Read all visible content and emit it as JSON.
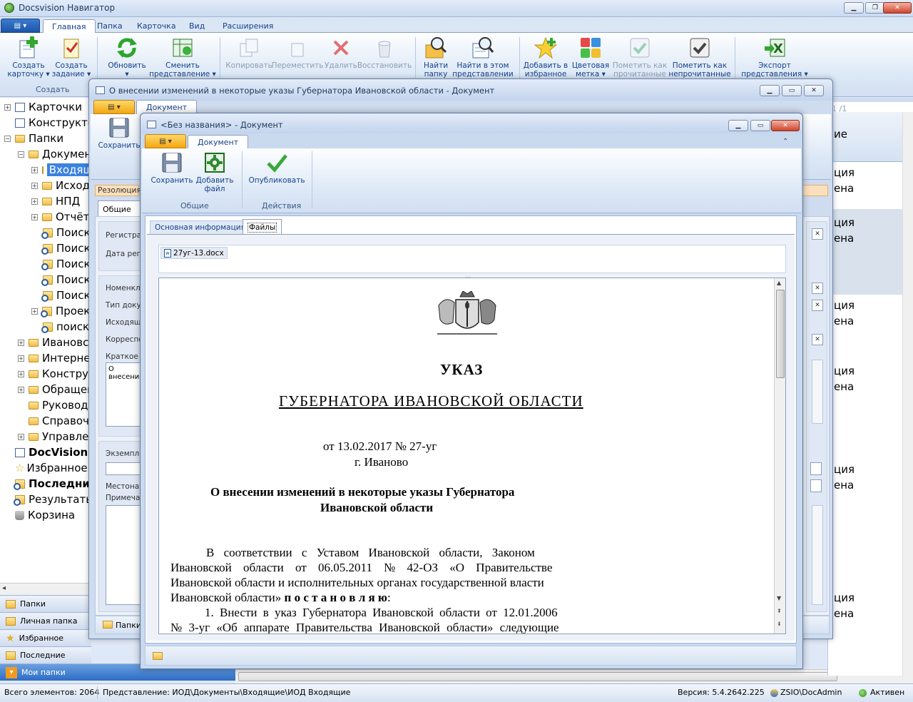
{
  "app": {
    "title": "Docsvision Навигатор",
    "menu_tabs": [
      "Главная",
      "Папка",
      "Карточка",
      "Вид",
      "Расширения"
    ]
  },
  "ribbon": {
    "create_card": "Создать\nкарточку ▾",
    "create_task": "Создать\nзадание ▾",
    "group_create": "Создать",
    "refresh": "Обновить\n▾",
    "change_view": "Сменить\nпредставление ▾",
    "copy": "Копировать",
    "move": "Переместить",
    "delete": "Удалить",
    "restore": "Восстановить",
    "find_folder": "Найти\nпапку",
    "find_in_view": "Найти в этом\nпредставлении",
    "add_favorite": "Добавить в\nизбранное",
    "color_mark": "Цветовая\nметка ▾",
    "mark_read": "Пометить как\nпрочитанные",
    "mark_unread": "Пометить как\nнепрочитанные",
    "export_view": "Экспорт\nпредставления ▾"
  },
  "tree": {
    "items": [
      {
        "label": "Карточки",
        "expander": "+"
      },
      {
        "label": "Конструктор",
        "expander": ""
      },
      {
        "label": "Папки",
        "expander": "−"
      },
      {
        "label": "Документы",
        "expander": "−"
      },
      {
        "label": "Входящие",
        "expander": "+"
      },
      {
        "label": "Исходящие",
        "expander": "+"
      },
      {
        "label": "НПД",
        "expander": "+"
      },
      {
        "label": "Отчёты",
        "expander": "+"
      },
      {
        "label": "Поиск",
        "expander": ""
      },
      {
        "label": "Поиск",
        "expander": ""
      },
      {
        "label": "Поиск",
        "expander": ""
      },
      {
        "label": "Поиск",
        "expander": ""
      },
      {
        "label": "Поиск",
        "expander": ""
      },
      {
        "label": "Проекты",
        "expander": "+"
      },
      {
        "label": "поиск",
        "expander": ""
      },
      {
        "label": "Ивановской",
        "expander": "+"
      },
      {
        "label": "Интернет",
        "expander": "+"
      },
      {
        "label": "Конструктор",
        "expander": "+"
      },
      {
        "label": "Обращения",
        "expander": "+"
      },
      {
        "label": "Руководство",
        "expander": ""
      },
      {
        "label": "Справочники",
        "expander": ""
      },
      {
        "label": "Управление",
        "expander": "+"
      },
      {
        "label": "DocVision Архив",
        "expander": ""
      },
      {
        "label": "Избранное",
        "expander": ""
      },
      {
        "label": "Последние",
        "expander": ""
      },
      {
        "label": "Результаты",
        "expander": ""
      },
      {
        "label": "Корзина",
        "expander": ""
      }
    ]
  },
  "nav": {
    "folders": "Папки",
    "personal": "Личная папка",
    "favorites": "Избранное",
    "recent": "Последние",
    "my_folders": "Мои папки"
  },
  "right_column": [
    "ие",
    "ция",
    "ена",
    "ция",
    "ена",
    "ция",
    "ена",
    "ция",
    "ена",
    "ция",
    "ена",
    "ция",
    "ена"
  ],
  "status": {
    "total": "Всего элементов: 2064",
    "view": "Представление: ИОД\\Документы\\Входящие\\ИОД Входящие",
    "version": "Версия: 5.4.2642.225",
    "user": "ZSIO\\DocAdmin",
    "state": "Активен"
  },
  "window1": {
    "title": "О внесении изменений в некоторые указы Губернатора Ивановской области - Документ",
    "tab": "Документ",
    "save": "Сохранить",
    "resolution_tab": "Резолюция",
    "general_tab": "Общие ре",
    "fields": [
      "Регистра",
      "Дата реги",
      "Номенкла",
      "Тип доку",
      "Исходящ",
      "Корреспо",
      "Краткое с",
      "О внесени",
      "Экземпля",
      "Местонах",
      "Примечан"
    ],
    "bottom_folder": "Папки",
    "page_counter": "1 /1"
  },
  "window2": {
    "title": "<Без названия> - Документ",
    "tab": "Документ",
    "save": "Сохранить",
    "add_file": "Добавить\nфайл",
    "publish": "Опубликовать",
    "group_general": "Общие",
    "group_actions": "Действия",
    "tab_main": "Основная информация",
    "tab_files": "Файлы",
    "file_name": "27уг-13.docx"
  },
  "document": {
    "heading1": "УКАЗ",
    "heading2": "ГУБЕРНАТОРА ИВАНОВСКОЙ ОБЛАСТИ",
    "date_line": "от 13.02.2017 № 27-уг",
    "city": "г. Иваново",
    "subject1": "О внесении изменений в некоторые указы Губернатора",
    "subject2": "Ивановской области",
    "p1": "В соответствии с Уставом Ивановской области, Законом",
    "p2": "Ивановской области от 06.05.2011 № 42-ОЗ «О Правительстве",
    "p3": "Ивановской области и исполнительных органах государственной власти",
    "p4a": "Ивановской области» ",
    "p4b": "п о с т а н о в л я ю",
    "p4c": ":",
    "p5": "1. Внести в указ Губернатора Ивановской области от 12.01.2006",
    "p6": "№ 3-уг «Об аппарате Правительства Ивановской области» следующие"
  }
}
